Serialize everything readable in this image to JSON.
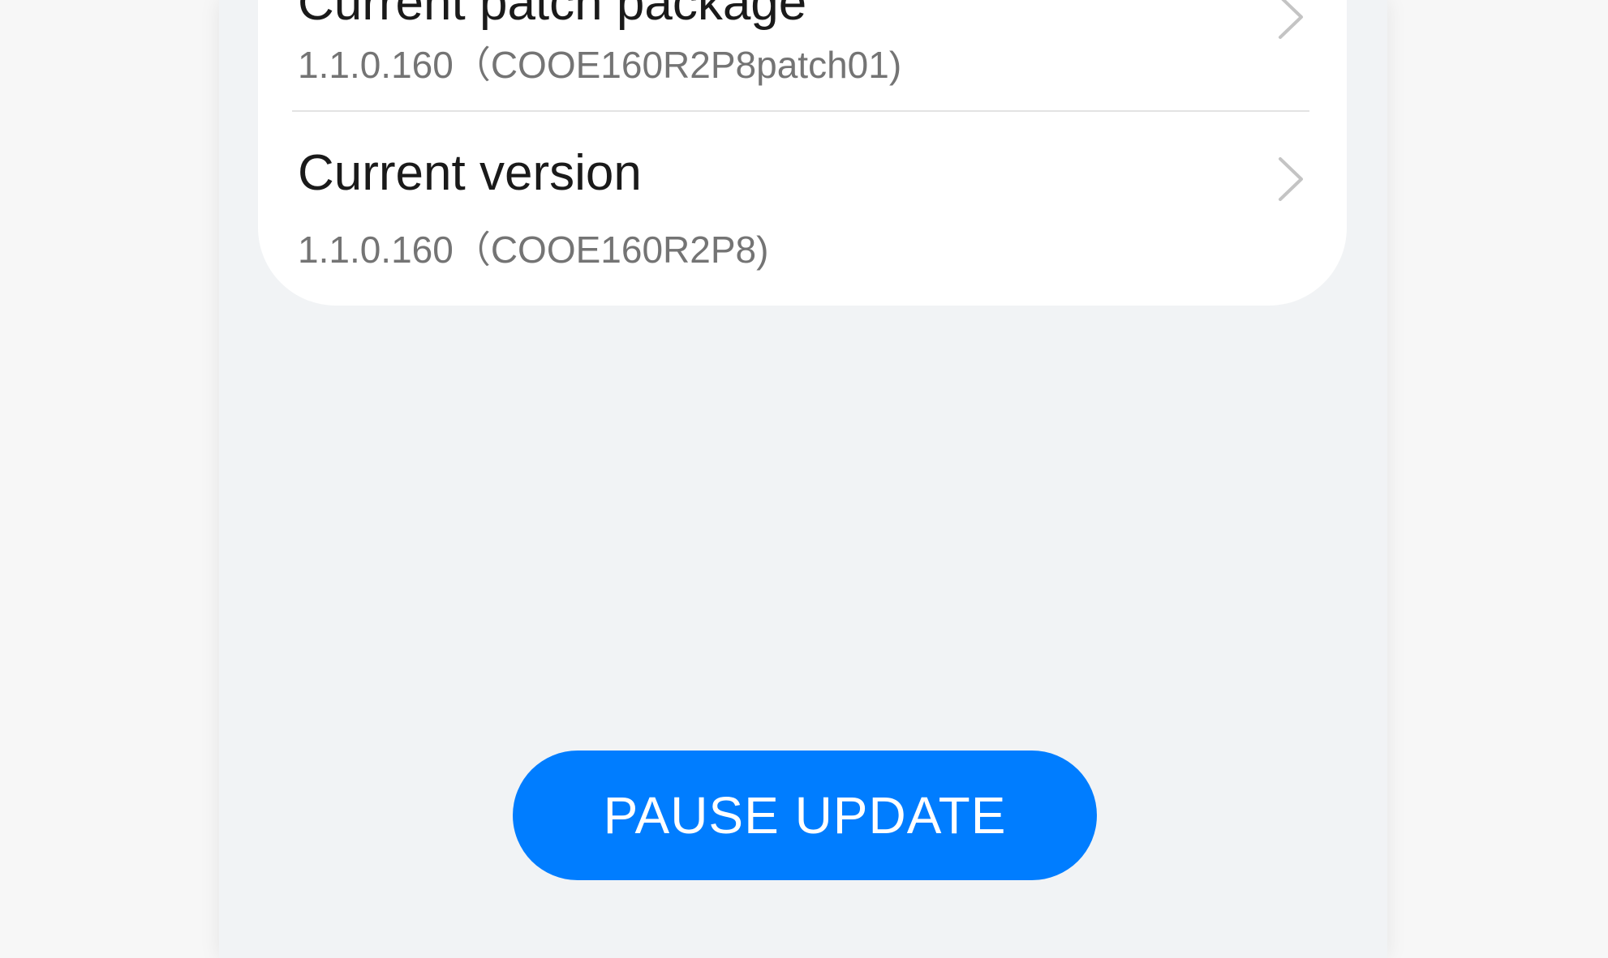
{
  "version_list": {
    "items": [
      {
        "title": "Current patch package",
        "subtitle": "1.1.0.160（COOE160R2P8patch01)"
      },
      {
        "title": "Current version",
        "subtitle": "1.1.0.160（COOE160R2P8)"
      }
    ]
  },
  "actions": {
    "pause_label": "PAUSE UPDATE"
  },
  "colors": {
    "accent": "#007dff",
    "panel_background": "#f1f3f5",
    "card_background": "#ffffff"
  },
  "icons": {
    "row_chevron": "chevron-right-icon"
  }
}
